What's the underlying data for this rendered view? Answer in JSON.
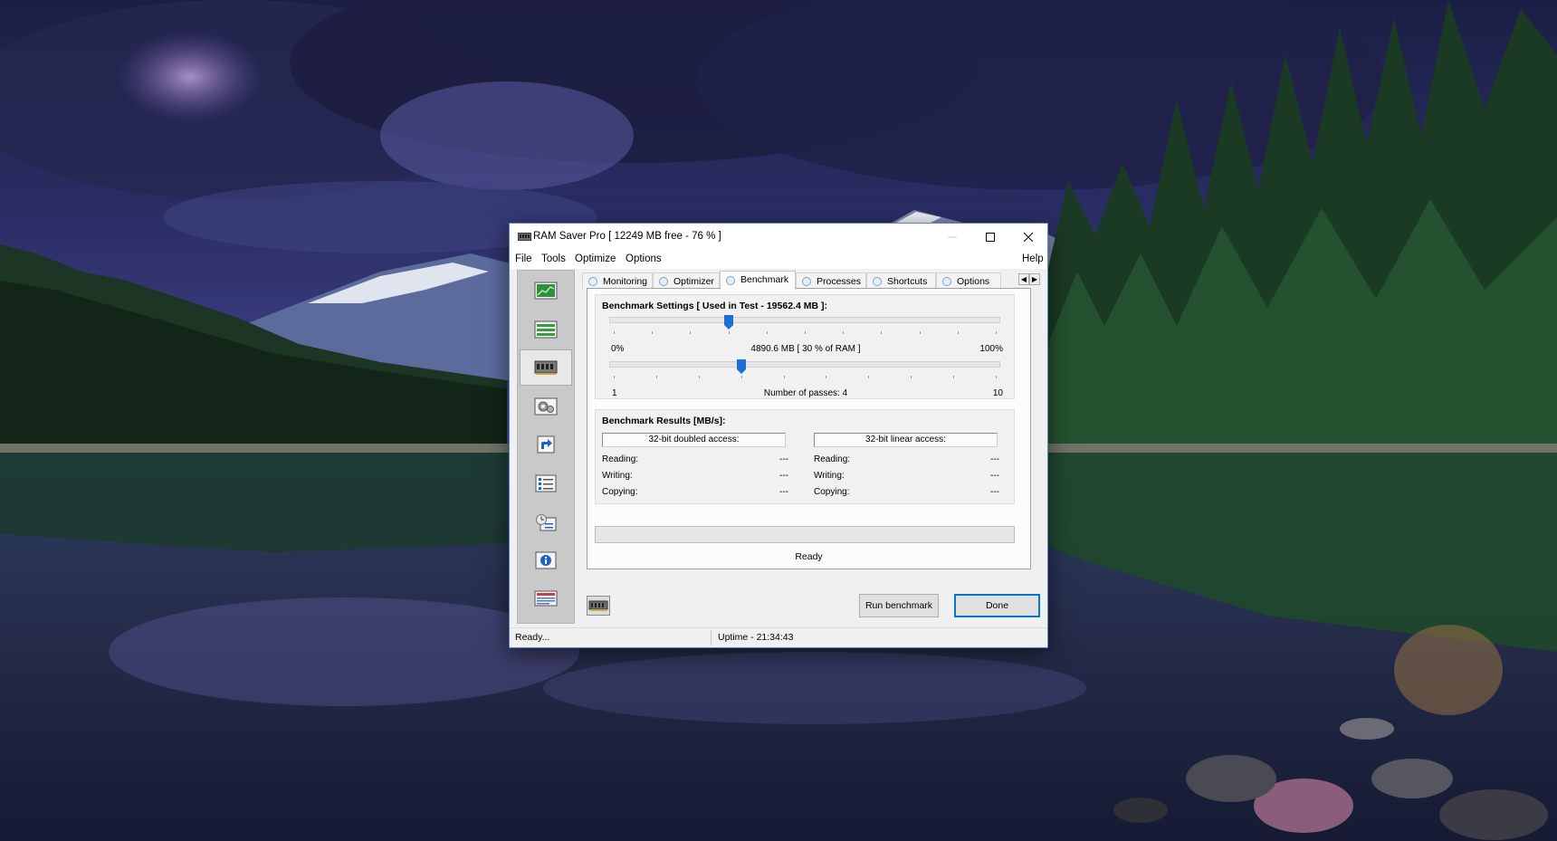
{
  "window": {
    "title": "RAM Saver Pro [ 12249 MB free - 76 % ]"
  },
  "menu": {
    "items": [
      "File",
      "Tools",
      "Optimize",
      "Options"
    ],
    "help": "Help"
  },
  "sidebar": {
    "icons": [
      "monitor-chart-icon",
      "list-icon",
      "ram-chip-icon",
      "gears-icon",
      "shortcut-icon",
      "checklist-icon",
      "schedule-icon",
      "info-icon",
      "news-icon"
    ],
    "active_index": 2
  },
  "tabs": {
    "items": [
      "Monitoring",
      "Optimizer",
      "Benchmark",
      "Processes",
      "Shortcuts",
      "Options"
    ],
    "active_index": 2
  },
  "settings": {
    "title": "Benchmark Settings [ Used in Test - 19562.4 MB ]:",
    "ram_slider": {
      "min_label": "0%",
      "max_label": "100%",
      "value_label": "4890.6 MB [ 30 % of RAM ]",
      "value_percent": 30
    },
    "passes_slider": {
      "min_label": "1",
      "max_label": "10",
      "value_label": "Number of passes: 4",
      "value": 4,
      "min": 1,
      "max": 10
    }
  },
  "results": {
    "title": "Benchmark Results [MB/s]:",
    "doubled": {
      "header": "32-bit doubled access:",
      "reading_label": "Reading:",
      "reading_value": "---",
      "writing_label": "Writing:",
      "writing_value": "---",
      "copying_label": "Copying:",
      "copying_value": "---"
    },
    "linear": {
      "header": "32-bit linear access:",
      "reading_label": "Reading:",
      "reading_value": "---",
      "writing_label": "Writing:",
      "writing_value": "---",
      "copying_label": "Copying:",
      "copying_value": "---"
    }
  },
  "progress": {
    "value_percent": 0,
    "status": "Ready"
  },
  "buttons": {
    "run": "Run benchmark",
    "done": "Done"
  },
  "statusbar": {
    "left": "Ready...",
    "uptime": "Uptime - 21:34:43"
  },
  "colors": {
    "accent": "#0078d7",
    "slider_thumb": "#1c6fd6",
    "progress_fill": "#06b025"
  }
}
